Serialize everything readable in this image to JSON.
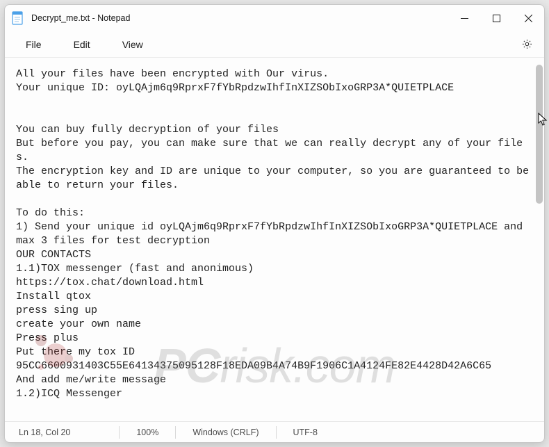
{
  "window": {
    "title": "Decrypt_me.txt - Notepad"
  },
  "menubar": {
    "items": [
      "File",
      "Edit",
      "View"
    ]
  },
  "document": {
    "text": "All your files have been encrypted with Our virus.\nYour unique ID: oyLQAjm6q9RprxF7fYbRpdzwIhfInXIZSObIxoGRP3A*QUIETPLACE\n\n\nYou can buy fully decryption of your files\nBut before you pay, you can make sure that we can really decrypt any of your files.\nThe encryption key and ID are unique to your computer, so you are guaranteed to be able to return your files.\n\nTo do this:\n1) Send your unique id oyLQAjm6q9RprxF7fYbRpdzwIhfInXIZSObIxoGRP3A*QUIETPLACE and max 3 files for test decryption\nOUR CONTACTS\n1.1)TOX messenger (fast and anonimous)\nhttps://tox.chat/download.html\nInstall qtox\npress sing up\ncreate your own name\nPress plus\nPut there my tox ID\n95CC6600931403C55E64134375095128F18EDA09B4A74B9F1906C1A4124FE82E4428D42A6C65\nAnd add me/write message\n1.2)ICQ Messenger"
  },
  "statusbar": {
    "position": "Ln 18, Col 20",
    "zoom": "100%",
    "line_ending": "Windows (CRLF)",
    "encoding": "UTF-8"
  },
  "watermark": {
    "text_prefix": "PC",
    "text_suffix": "risk.com"
  }
}
